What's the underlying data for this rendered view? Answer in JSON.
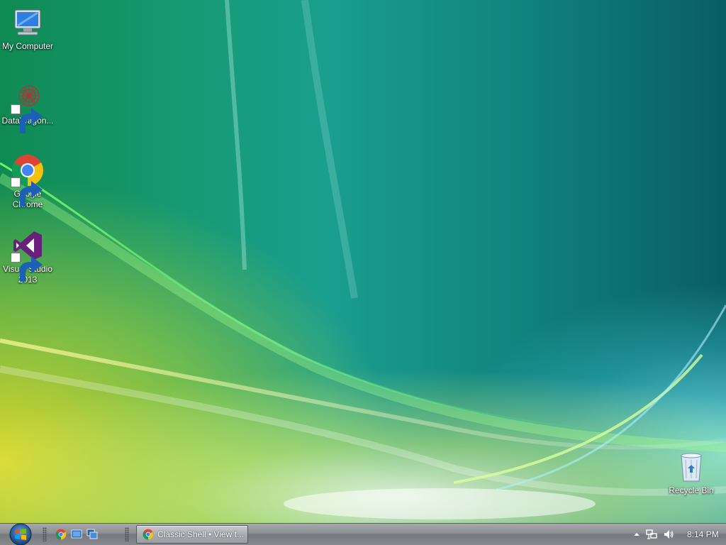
{
  "desktop": {
    "icons": [
      {
        "label": "My Computer"
      },
      {
        "label": "DataWagon..."
      },
      {
        "label": "Google\nChrome"
      },
      {
        "label": "Visual Studio\n2013"
      },
      {
        "label": "Recycle Bin"
      }
    ]
  },
  "taskbar": {
    "active_window_label": "Classic Shell • View t...",
    "clock": "8:14 PM"
  },
  "colors": {
    "wallpaper_teal": "#169a73",
    "wallpaper_yellow": "#e6dc28",
    "taskbar_gray": "#8b8e93"
  }
}
